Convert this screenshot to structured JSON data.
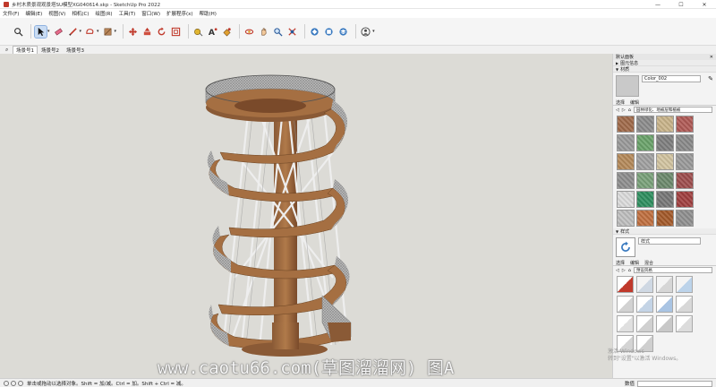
{
  "window": {
    "title": "乡村木质景观观景塔SU模型XG040614.skp - SketchUp Pro 2022",
    "min": "—",
    "max": "☐",
    "close": "✕"
  },
  "menu": [
    "文件(F)",
    "编辑(E)",
    "视图(V)",
    "相机(C)",
    "绘图(R)",
    "工具(T)",
    "窗口(W)",
    "扩展程序(x)",
    "帮助(H)"
  ],
  "toolbar": {
    "tools": [
      "search-icon",
      "select-arrow-icon",
      "eraser-icon",
      "pencil-icon",
      "shape-icon",
      "paint-bucket-icon",
      "move-icon",
      "push-pull-icon",
      "rotate-icon",
      "offset-icon",
      "tape-measure-icon",
      "text-icon",
      "paint-icon",
      "orbit-icon",
      "pan-icon",
      "zoom-extents-icon",
      "warehouse-icon",
      "extension-icon",
      "layers-icon",
      "account-icon"
    ]
  },
  "scenes": {
    "tabs": [
      "场景号1",
      "场景号2",
      "场景号3"
    ]
  },
  "tray": {
    "title": "默认面板",
    "sections": {
      "entity_info": "图元信息",
      "materials": "材质",
      "styles": "样式"
    },
    "materials": {
      "name": "Color_002",
      "tab_select": "选择",
      "tab_edit": "编辑",
      "library": "园林绿化、地被层和植被",
      "swatch_colors": [
        "#a06a4a",
        "#8c8c8c",
        "#c9b48a",
        "#b05a56",
        "#9a9a9a",
        "#6aa36a",
        "#7f7f7f",
        "#8a8a8a",
        "#b58a5a",
        "#a0a0a0",
        "#d2c4a0",
        "#9a9a9a",
        "#8e8e8e",
        "#7aa27a",
        "#6c8a6c",
        "#9e4e4e",
        "#dcdcdc",
        "#2f8f5f",
        "#777777",
        "#a04040",
        "#bfbfbf",
        "#c07040",
        "#a45a2a",
        "#909090"
      ]
    },
    "styles": {
      "name": "样式",
      "tab_select": "选择",
      "tab_edit": "编辑",
      "tab_mix": "混合",
      "collection": "预设风格"
    }
  },
  "status": {
    "message": "单击或拖动以选择对象。Shift = 加/减。Ctrl = 加。Shift + Ctrl = 减。",
    "vcb_label": "数值"
  },
  "watermark": "www.caotu66.com(草图溜溜网) 图A",
  "activation": {
    "line1": "激活 Windows",
    "line2": "转到\"设置\"以激活 Windows。"
  }
}
